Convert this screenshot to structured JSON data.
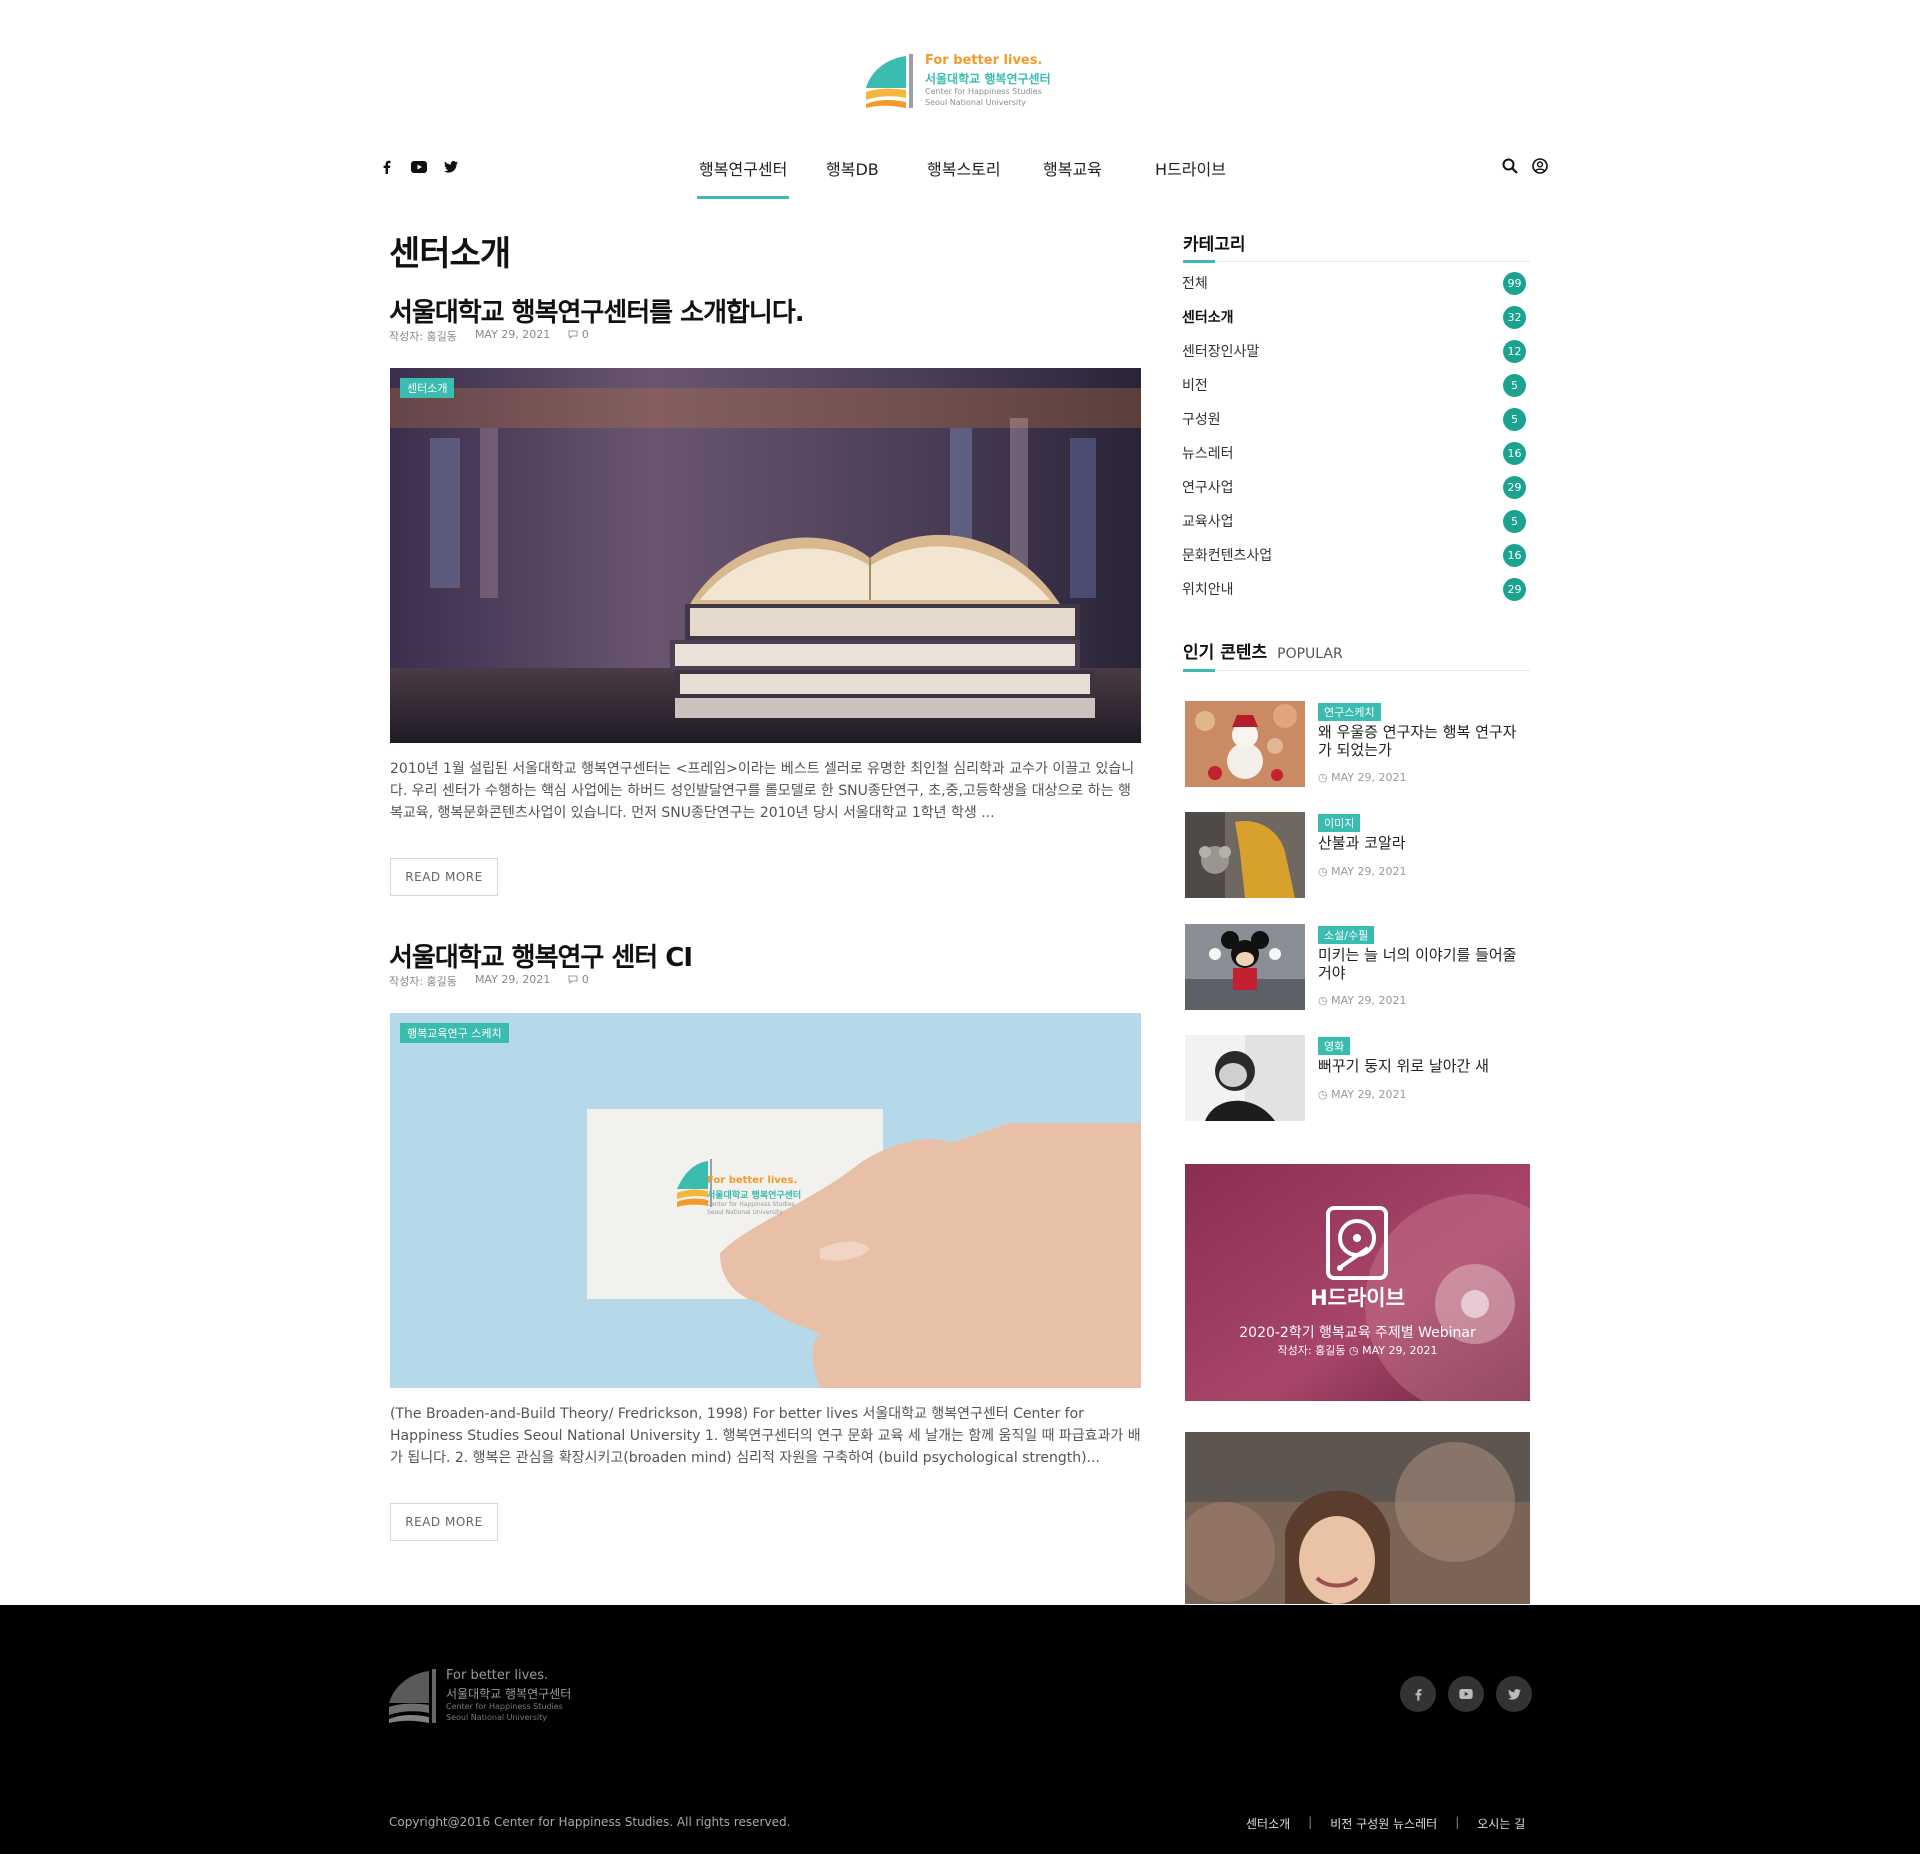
{
  "brand": {
    "slogan": "For better lives.",
    "name": "서울대학교 행복연구센터",
    "en_line1": "Center for Happiness Studies",
    "en_line2": "Seoul National University"
  },
  "nav": {
    "items": [
      "행복연구센터",
      "행복DB",
      "행복스토리",
      "행복교육",
      "H드라이브"
    ],
    "active": "행복연구센터"
  },
  "page_title": "센터소개",
  "posts": [
    {
      "title": "서울대학교 행복연구센터를 소개합니다.",
      "author": "작성자: 홍길동",
      "date": "MAY 29, 2021",
      "comments": "0",
      "tag": "센터소개",
      "excerpt": "2010년 1월 설립된 서울대학교 행복연구센터는 <프레임>이라는 베스트 셀러로 유명한 최인철 심리학과 교수가 이끌고 있습니다. 우리 센터가 수행하는 핵심 사업에는 하버드 성인발달연구를 롤모델로 한 SNU종단연구, 초,중,고등학생을 대상으로 하는 행복교육, 행복문화콘텐츠사업이 있습니다. 먼저 SNU종단연구는 2010년 당시 서울대학교 1학년 학생 ...",
      "read_more": "READ MORE"
    },
    {
      "title": "서울대학교 행복연구 센터 CI",
      "author": "작성자: 홍길동",
      "date": "MAY 29, 2021",
      "comments": "0",
      "tag": "행복교육연구 스케치",
      "excerpt": "(The Broaden-and-Build Theory/ Fredrickson, 1998) For better lives 서울대학교 행복연구센터 Center for Happiness Studies Seoul National University 1. 행복연구센터의 연구 문화 교육 세 날개는 함께 움직일 때 파급효과가 배가 됩니다. 2. 행복은 관심을 확장시키고(broaden mind) 심리적 자원을 구축하여 (build psychological strength)...",
      "read_more": "READ MORE"
    }
  ],
  "sidebar": {
    "categories_title": "카테고리",
    "categories": [
      {
        "label": "전체",
        "count": "99"
      },
      {
        "label": "센터소개",
        "count": "32"
      },
      {
        "label": "센터장인사말",
        "count": "12"
      },
      {
        "label": "비전",
        "count": "5"
      },
      {
        "label": "구성원",
        "count": "5"
      },
      {
        "label": "뉴스레터",
        "count": "16"
      },
      {
        "label": "연구사업",
        "count": "29"
      },
      {
        "label": "교육사업",
        "count": "5"
      },
      {
        "label": "문화컨텐츠사업",
        "count": "16"
      },
      {
        "label": "위치안내",
        "count": "29"
      }
    ],
    "active_category": "센터소개",
    "popular_title": "인기 콘텐츠",
    "popular_sub": "POPULAR",
    "popular": [
      {
        "tag": "연구스케치",
        "title": "왜 우울증 연구자는 행복 연구자가 되었는가",
        "date": "MAY 29, 2021"
      },
      {
        "tag": "이미지",
        "title": "산불과 코알라",
        "date": "MAY 29, 2021"
      },
      {
        "tag": "소설/수필",
        "title": "미키는 늘 너의 이야기를 들어줄 거야",
        "date": "MAY 29, 2021"
      },
      {
        "tag": "영화",
        "title": "뻐꾸기 둥지 위로 날아간 새",
        "date": "MAY 29, 2021"
      }
    ],
    "feature": {
      "label": "H드라이브",
      "title": "2020-2학기 행복교육 주제별 Webinar",
      "author": "작성자: 홍길동",
      "date": "MAY 29, 2021"
    }
  },
  "footer": {
    "copyright": "Copyright@2016 Center for Happiness Studies. All rights reserved.",
    "links": [
      "센터소개",
      "비전 구성원 뉴스레터",
      "오시는 길"
    ]
  },
  "colors": {
    "accent": "#3bbcb0",
    "badge": "#1aa38f",
    "orange": "#f39a2b",
    "footer_bg": "#000000"
  }
}
